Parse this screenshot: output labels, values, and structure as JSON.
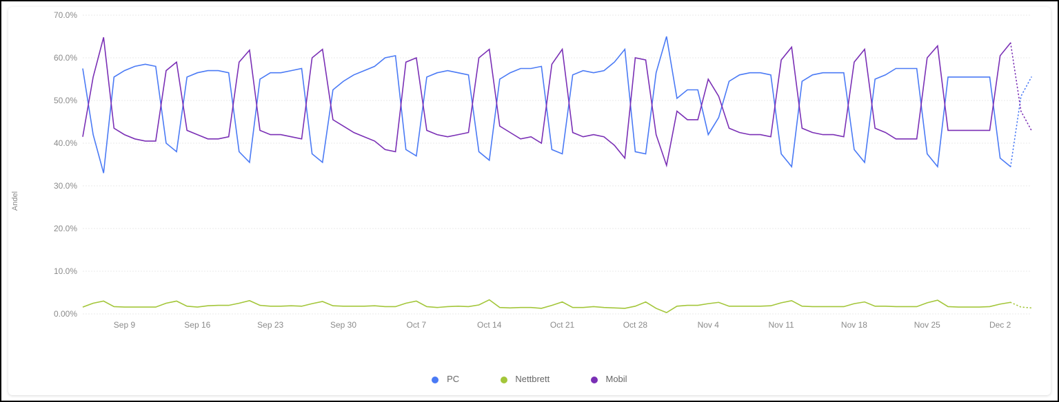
{
  "chart_data": {
    "type": "line",
    "ylabel": "Andel",
    "ylim": [
      0,
      70
    ],
    "y_ticks": [
      0,
      10,
      20,
      30,
      40,
      50,
      60,
      70
    ],
    "y_tick_labels": [
      "0.00%",
      "10.0%",
      "20.0%",
      "30.0%",
      "40.0%",
      "50.0%",
      "60.0%",
      "70.0%"
    ],
    "x_tick_labels": [
      "Sep 9",
      "Sep 16",
      "Sep 23",
      "Sep 30",
      "Oct 7",
      "Oct 14",
      "Oct 21",
      "Oct 28",
      "Nov 4",
      "Nov 11",
      "Nov 18",
      "Nov 25",
      "Dec 2"
    ],
    "x_tick_indices": [
      4,
      11,
      18,
      25,
      32,
      39,
      46,
      53,
      60,
      67,
      74,
      81,
      88
    ],
    "n_points": 92,
    "dotted_tail": 2,
    "series": [
      {
        "name": "PC",
        "color": "#4a7af5",
        "values": [
          57.5,
          42.0,
          33.0,
          55.5,
          57.0,
          58.0,
          58.5,
          58.0,
          40.0,
          38.0,
          55.5,
          56.5,
          57.0,
          57.0,
          56.5,
          38.0,
          35.5,
          55.0,
          56.5,
          56.5,
          57.0,
          57.5,
          37.5,
          35.5,
          52.5,
          54.5,
          56.0,
          57.0,
          58.0,
          60.0,
          60.5,
          38.5,
          37.0,
          55.5,
          56.5,
          57.0,
          56.5,
          56.0,
          38.0,
          36.0,
          55.0,
          56.5,
          57.5,
          57.5,
          58.0,
          38.5,
          37.5,
          56.0,
          57.0,
          56.5,
          57.0,
          59.0,
          62.0,
          38.0,
          37.5,
          56.5,
          65.0,
          50.5,
          52.5,
          52.5,
          42.0,
          46.0,
          54.5,
          56.0,
          56.5,
          56.5,
          56.0,
          37.5,
          34.5,
          54.5,
          56.0,
          56.5,
          56.5,
          56.5,
          38.5,
          35.5,
          55.0,
          56.0,
          57.5,
          57.5,
          57.5,
          37.5,
          34.5,
          55.5,
          55.5,
          55.5,
          55.5,
          55.5,
          36.5,
          34.5,
          51.0,
          55.5
        ]
      },
      {
        "name": "Nettbrett",
        "color": "#a3c639",
        "values": [
          1.6,
          2.5,
          3.0,
          1.7,
          1.6,
          1.6,
          1.6,
          1.6,
          2.5,
          3.0,
          1.8,
          1.6,
          1.9,
          2.0,
          2.0,
          2.5,
          3.1,
          2.0,
          1.8,
          1.8,
          1.9,
          1.8,
          2.4,
          2.9,
          1.9,
          1.8,
          1.8,
          1.8,
          1.9,
          1.7,
          1.7,
          2.5,
          3.0,
          1.7,
          1.5,
          1.7,
          1.8,
          1.7,
          2.1,
          3.3,
          1.5,
          1.4,
          1.5,
          1.5,
          1.3,
          2.0,
          2.8,
          1.5,
          1.5,
          1.7,
          1.5,
          1.4,
          1.3,
          1.8,
          2.8,
          1.3,
          0.3,
          1.8,
          2.0,
          2.0,
          2.4,
          2.7,
          1.8,
          1.8,
          1.8,
          1.8,
          1.9,
          2.6,
          3.1,
          1.8,
          1.7,
          1.7,
          1.7,
          1.7,
          2.4,
          2.8,
          1.8,
          1.8,
          1.7,
          1.7,
          1.7,
          2.6,
          3.2,
          1.7,
          1.6,
          1.6,
          1.6,
          1.7,
          2.3,
          2.7,
          1.6,
          1.4
        ]
      },
      {
        "name": "Mobil",
        "color": "#7a2fb5",
        "values": [
          41.5,
          55.5,
          64.8,
          43.5,
          42.0,
          41.0,
          40.5,
          40.5,
          57.0,
          59.0,
          43.0,
          42.0,
          41.0,
          41.0,
          41.5,
          59.0,
          61.8,
          43.0,
          42.0,
          42.0,
          41.5,
          41.0,
          60.0,
          62.0,
          45.5,
          44.0,
          42.5,
          41.5,
          40.5,
          38.5,
          38.0,
          59.0,
          60.0,
          43.0,
          42.0,
          41.5,
          42.0,
          42.5,
          60.0,
          62.0,
          44.0,
          42.5,
          41.0,
          41.5,
          40.0,
          58.5,
          62.0,
          42.5,
          41.5,
          42.0,
          41.5,
          39.5,
          36.5,
          60.0,
          59.5,
          42.0,
          34.8,
          47.5,
          45.5,
          45.5,
          55.0,
          51.0,
          43.5,
          42.5,
          42.0,
          42.0,
          41.5,
          59.5,
          62.5,
          43.5,
          42.5,
          42.0,
          42.0,
          41.5,
          59.0,
          62.0,
          43.5,
          42.5,
          41.0,
          41.0,
          41.0,
          60.0,
          62.8,
          43.0,
          43.0,
          43.0,
          43.0,
          43.0,
          60.5,
          63.5,
          47.5,
          43.0
        ]
      }
    ]
  },
  "legend": {
    "pc": "PC",
    "nettbrett": "Nettbrett",
    "mobil": "Mobil"
  }
}
